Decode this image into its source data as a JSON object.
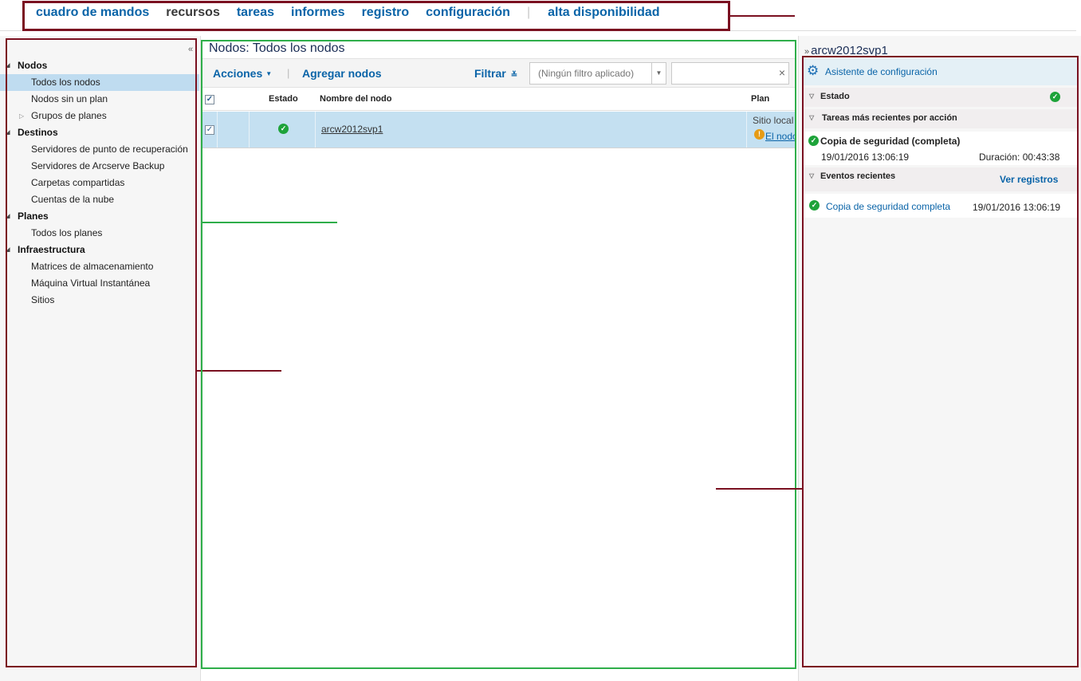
{
  "nav": {
    "items": [
      "cuadro de mandos",
      "recursos",
      "tareas",
      "informes",
      "registro",
      "configuración"
    ],
    "active": "recursos",
    "separator": "|",
    "extra": "alta disponibilidad"
  },
  "sidebar": {
    "collapse_icon": "double-chevron-left-icon",
    "groups": [
      {
        "label": "Nodos",
        "items": [
          "Todos los nodos",
          "Nodos sin un plan",
          "Grupos de planes"
        ]
      },
      {
        "label": "Destinos",
        "items": [
          "Servidores de punto de recuperación",
          "Servidores de Arcserve Backup",
          "Carpetas compartidas",
          "Cuentas de la nube"
        ]
      },
      {
        "label": "Planes",
        "items": [
          "Todos los planes"
        ]
      },
      {
        "label": "Infraestructura",
        "items": [
          "Matrices de almacenamiento",
          "Máquina Virtual Instantánea",
          "Sitios"
        ]
      }
    ],
    "selected": "Todos los nodos"
  },
  "main": {
    "title": "Nodos: Todos los nodos",
    "toolbar": {
      "actions_label": "Acciones",
      "separator": "|",
      "add_label": "Agregar nodos",
      "filter_label": "Filtrar",
      "filter_placeholder": "(Ningún filtro aplicado)",
      "search_value": ""
    },
    "table": {
      "columns": [
        "Estado",
        "Nombre del nodo",
        "Plan"
      ],
      "rows": [
        {
          "checked": true,
          "status": "ok",
          "name": "arcw2012svp1",
          "plan_line1": "Sitio local",
          "plan_link": "El nodo"
        }
      ]
    }
  },
  "details": {
    "title": "arcw2012svp1",
    "wizard_label": "Asistente de configuración",
    "status_label": "Estado",
    "recent_jobs_label": "Tareas más recientes por acción",
    "job": {
      "name": "Copia de seguridad (completa)",
      "date": "19/01/2016 13:06:19",
      "duration": "Duración: 00:43:38"
    },
    "events_label": "Eventos recientes",
    "view_logs_label": "Ver registros",
    "event": {
      "name": "Copia de seguridad completa",
      "date": "19/01/2016 13:06:19"
    }
  },
  "colors": {
    "annotation_red": "#7a1020",
    "annotation_green": "#2fae4a",
    "link_blue": "#0a64a8",
    "selected_row": "#c4e0f1",
    "ok_green": "#1ea33a",
    "warn_orange": "#e69b14"
  }
}
